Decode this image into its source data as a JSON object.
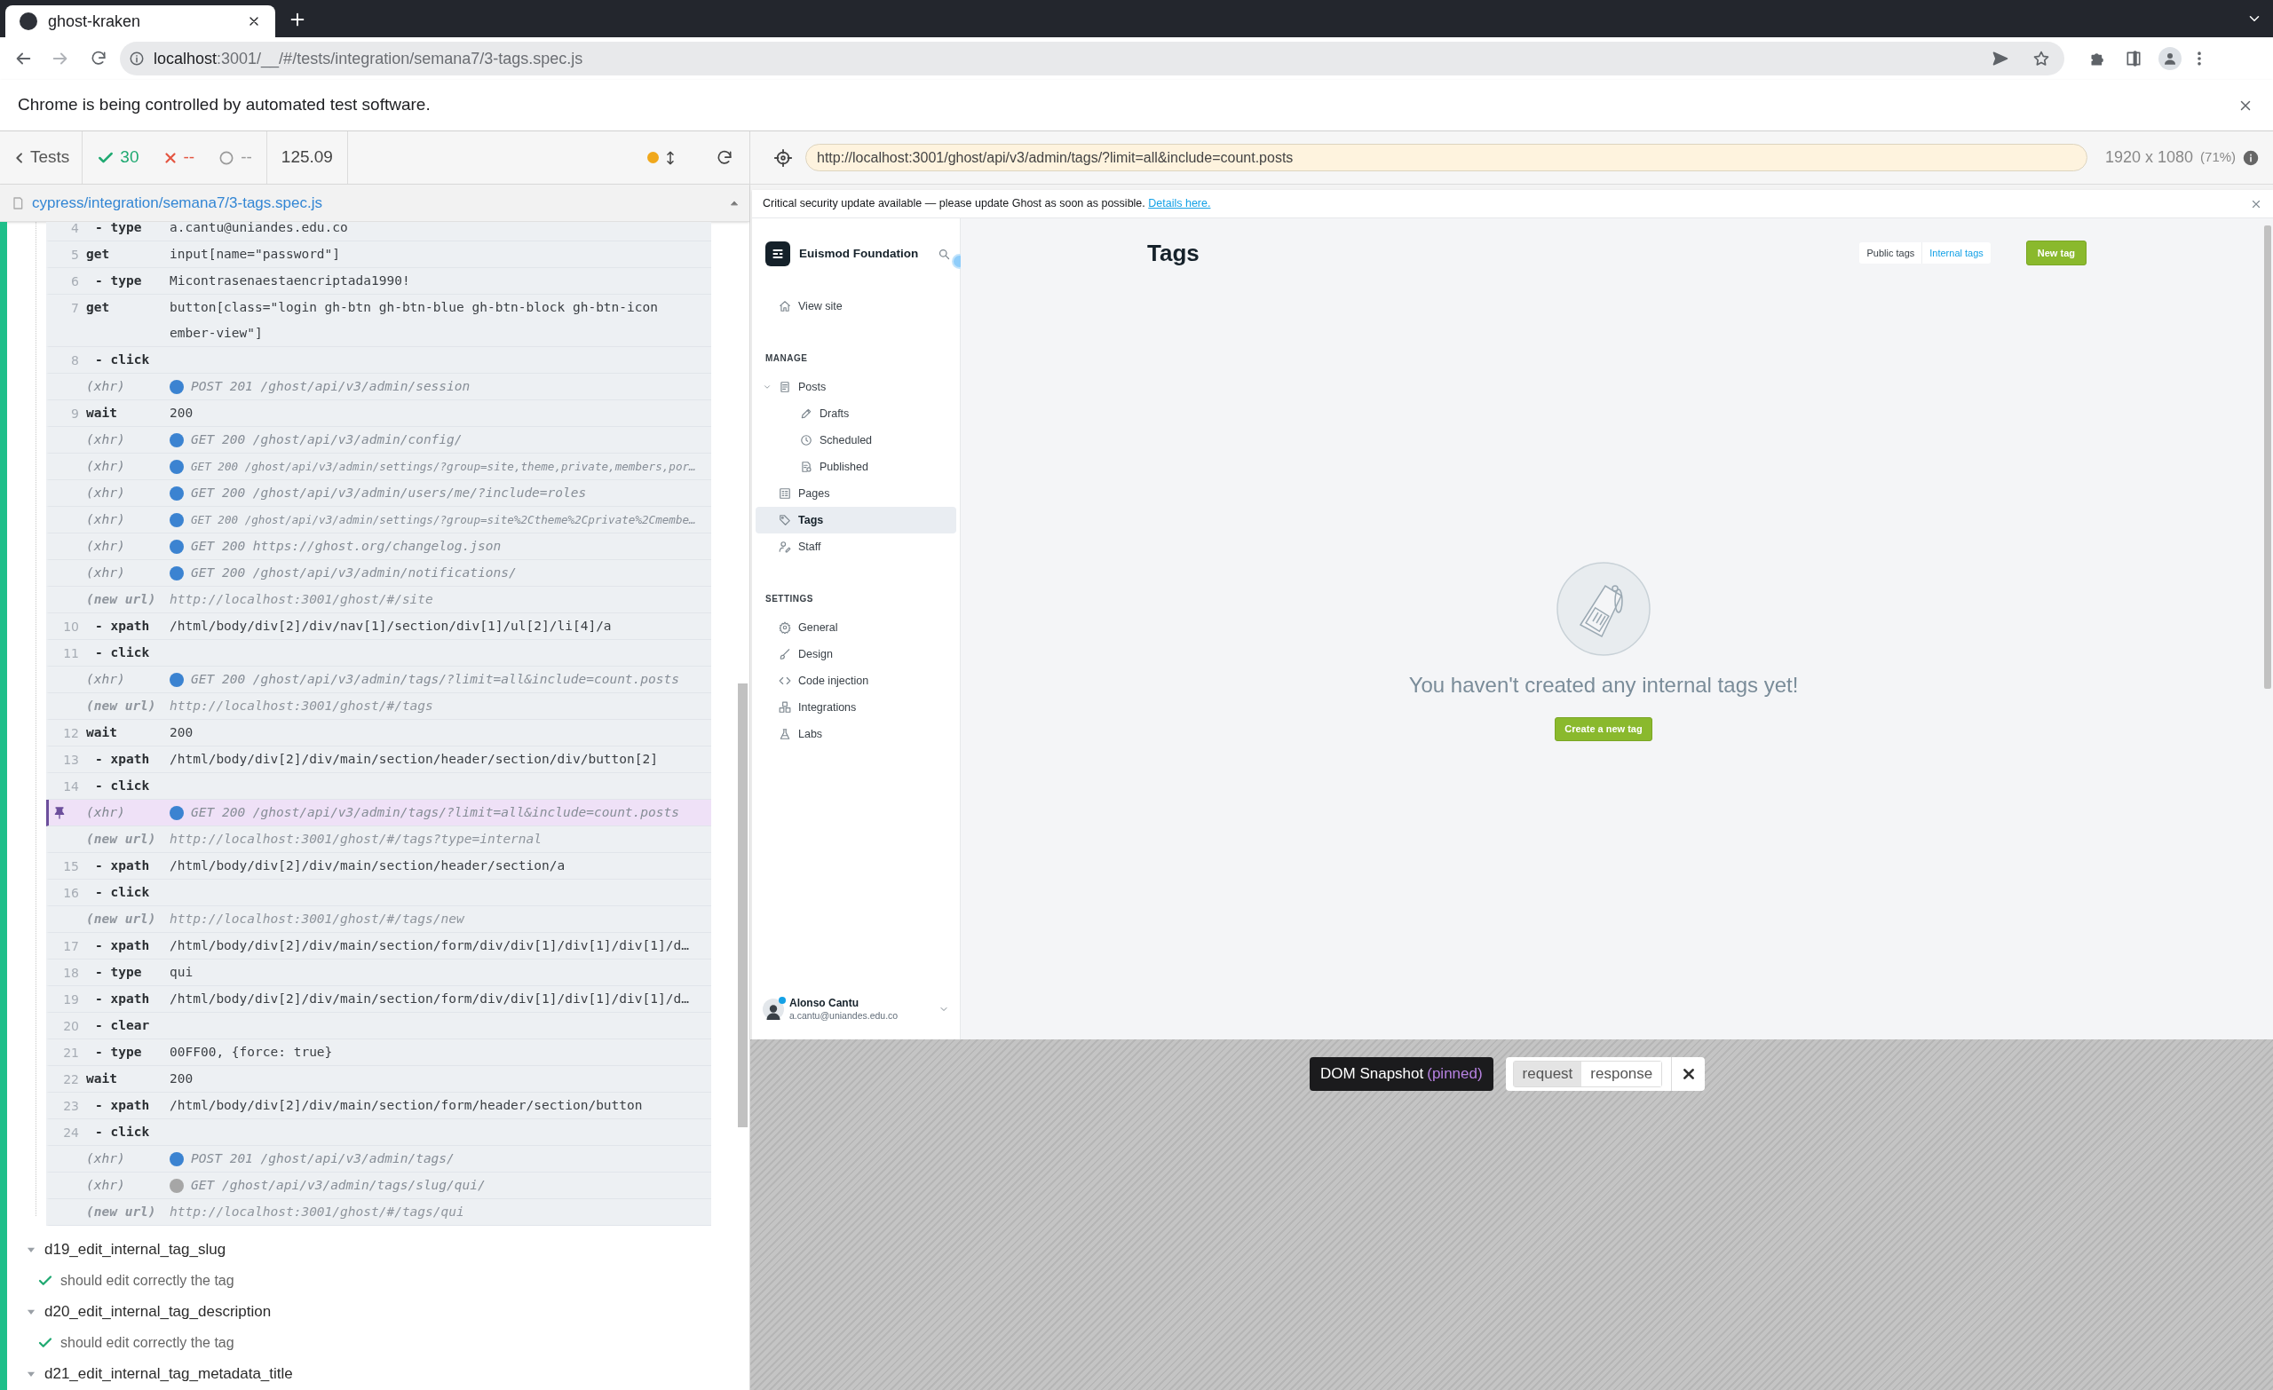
{
  "browser": {
    "tab_title": "ghost-kraken",
    "url_host": "localhost",
    "url_path": ":3001/__/#/tests/integration/semana7/3-tags.spec.js",
    "infobar": "Chrome is being controlled by automated test software."
  },
  "runner": {
    "back_label": "Tests",
    "passed": "30",
    "failed": "--",
    "pending": "--",
    "duration": "125.09",
    "spec_path": "cypress/integration/semana7/3-tags.spec.js",
    "aut_url": "http://localhost:3001/ghost/api/v3/admin/tags/?limit=all&include=count.posts",
    "viewport": "1920 x 1080",
    "scale": "(71%)"
  },
  "command_log": [
    {
      "number": "4",
      "kind": "child",
      "name": "- type",
      "message": "a.cantu@uniandes.edu.co",
      "pinned": false,
      "dense": false
    },
    {
      "number": "5",
      "kind": "command",
      "name": "get",
      "message": "input[name=\"password\"]",
      "pinned": false,
      "dense": false
    },
    {
      "number": "6",
      "kind": "child",
      "name": "- type",
      "message": "Micontrasenaestaencriptada1990!",
      "pinned": false,
      "dense": false
    },
    {
      "number": "7",
      "kind": "command",
      "name": "get",
      "message": "button[class=\"login gh-btn gh-btn-blue gh-btn-block gh-btn-icon ember-view\"]",
      "pinned": false,
      "dense": false
    },
    {
      "number": "8",
      "kind": "child",
      "name": "- click",
      "pinned": false
    },
    {
      "kind": "xhr",
      "name": "(xhr)",
      "message": "POST 201 /ghost/api/v3/admin/session",
      "color": "#3b83d1",
      "pinned": false,
      "dense": false
    },
    {
      "number": "9",
      "kind": "command",
      "name": "wait",
      "message": "200",
      "pinned": false,
      "dense": false
    },
    {
      "kind": "xhr",
      "name": "(xhr)",
      "message": "GET 200 /ghost/api/v3/admin/config/",
      "color": "#3b83d1",
      "pinned": false,
      "dense": false
    },
    {
      "kind": "xhr",
      "name": "(xhr)",
      "message": "GET 200 /ghost/api/v3/admin/settings/?group=site,theme,private,members,por…",
      "color": "#3b83d1",
      "pinned": false,
      "dense": true
    },
    {
      "kind": "xhr",
      "name": "(xhr)",
      "message": "GET 200 /ghost/api/v3/admin/users/me/?include=roles",
      "color": "#3b83d1",
      "pinned": false,
      "dense": false
    },
    {
      "kind": "xhr",
      "name": "(xhr)",
      "message": "GET 200 /ghost/api/v3/admin/settings/?group=site%2Ctheme%2Cprivate%2Cmembe…",
      "color": "#3b83d1",
      "pinned": false,
      "dense": true
    },
    {
      "kind": "xhr",
      "name": "(xhr)",
      "message": "GET 200 https://ghost.org/changelog.json",
      "color": "#3b83d1",
      "pinned": false,
      "dense": false
    },
    {
      "kind": "xhr",
      "name": "(xhr)",
      "message": "GET 200 /ghost/api/v3/admin/notifications/",
      "color": "#3b83d1",
      "pinned": false,
      "dense": false
    },
    {
      "kind": "newurl",
      "name": "(new url)",
      "message": "http://localhost:3001/ghost/#/site",
      "pinned": false,
      "dense": false
    },
    {
      "number": "10",
      "kind": "child",
      "name": "- xpath",
      "message": "/html/body/div[2]/div/nav[1]/section/div[1]/ul[2]/li[4]/a",
      "pinned": false,
      "dense": false
    },
    {
      "number": "11",
      "kind": "child",
      "name": "- click",
      "pinned": false
    },
    {
      "kind": "xhr",
      "name": "(xhr)",
      "message": "GET 200 /ghost/api/v3/admin/tags/?limit=all&include=count.posts",
      "color": "#3b83d1",
      "pinned": false,
      "dense": false
    },
    {
      "kind": "newurl",
      "name": "(new url)",
      "message": "http://localhost:3001/ghost/#/tags",
      "pinned": false,
      "dense": false
    },
    {
      "number": "12",
      "kind": "command",
      "name": "wait",
      "message": "200",
      "pinned": false,
      "dense": false
    },
    {
      "number": "13",
      "kind": "child",
      "name": "- xpath",
      "message": "/html/body/div[2]/div/main/section/header/section/div/button[2]",
      "pinned": false,
      "dense": false
    },
    {
      "number": "14",
      "kind": "child",
      "name": "- click",
      "pinned": false
    },
    {
      "kind": "xhr",
      "name": "(xhr)",
      "message": "GET 200 /ghost/api/v3/admin/tags/?limit=all&include=count.posts",
      "color": "#3b83d1",
      "pinned": true,
      "dense": false
    },
    {
      "kind": "newurl",
      "name": "(new url)",
      "message": "http://localhost:3001/ghost/#/tags?type=internal",
      "pinned": false,
      "dense": false
    },
    {
      "number": "15",
      "kind": "child",
      "name": "- xpath",
      "message": "/html/body/div[2]/div/main/section/header/section/a",
      "pinned": false,
      "dense": false
    },
    {
      "number": "16",
      "kind": "child",
      "name": "- click",
      "pinned": false
    },
    {
      "kind": "newurl",
      "name": "(new url)",
      "message": "http://localhost:3001/ghost/#/tags/new",
      "pinned": false,
      "dense": false
    },
    {
      "number": "17",
      "kind": "child",
      "name": "- xpath",
      "message": "/html/body/div[2]/div/main/section/form/div/div[1]/div[1]/div[1]/d…",
      "pinned": false,
      "dense": false
    },
    {
      "number": "18",
      "kind": "child",
      "name": "- type",
      "message": "qui",
      "pinned": false,
      "dense": false
    },
    {
      "number": "19",
      "kind": "child",
      "name": "- xpath",
      "message": "/html/body/div[2]/div/main/section/form/div/div[1]/div[1]/div[1]/d…",
      "pinned": false,
      "dense": false
    },
    {
      "number": "20",
      "kind": "child",
      "name": "- clear",
      "pinned": false
    },
    {
      "number": "21",
      "kind": "child",
      "name": "- type",
      "message": "00FF00, {force: true}",
      "pinned": false,
      "dense": false
    },
    {
      "number": "22",
      "kind": "command",
      "name": "wait",
      "message": "200",
      "pinned": false,
      "dense": false
    },
    {
      "number": "23",
      "kind": "child",
      "name": "- xpath",
      "message": "/html/body/div[2]/div/main/section/form/header/section/button",
      "pinned": false,
      "dense": false
    },
    {
      "number": "24",
      "kind": "child",
      "name": "- click",
      "pinned": false
    },
    {
      "kind": "xhr",
      "name": "(xhr)",
      "message": "POST 201 /ghost/api/v3/admin/tags/",
      "color": "#3b83d1",
      "pinned": false,
      "dense": false
    },
    {
      "kind": "xhr",
      "name": "(xhr)",
      "message": "GET /ghost/api/v3/admin/tags/slug/qui/",
      "color": "#a6a6a6",
      "pinned": false,
      "dense": false
    },
    {
      "kind": "newurl",
      "name": "(new url)",
      "message": "http://localhost:3001/ghost/#/tags/qui",
      "pinned": false,
      "dense": false
    }
  ],
  "suites": [
    {
      "title": "d19_edit_internal_tag_slug",
      "expanded": true,
      "tests": [
        {
          "title": "should edit correctly the tag",
          "passed": true
        }
      ]
    },
    {
      "title": "d20_edit_internal_tag_description",
      "expanded": true,
      "tests": [
        {
          "title": "should edit correctly the tag",
          "passed": true
        }
      ]
    },
    {
      "title": "d21_edit_internal_tag_metadata_title",
      "expanded": true
    }
  ],
  "ghost": {
    "alert": "Critical security update available — please update Ghost as soon as possible.",
    "alert_link": "Details here.",
    "site_title": "Euismod Foundation",
    "view_site": "View site",
    "sections": [
      {
        "heading": "MANAGE",
        "items": [
          {
            "label": "Posts",
            "selected": false,
            "expanded": true,
            "children": [
              {
                "label": "Drafts",
                "selected": false
              },
              {
                "label": "Scheduled",
                "selected": false
              },
              {
                "label": "Published",
                "selected": false
              }
            ]
          },
          {
            "label": "Pages",
            "selected": false
          },
          {
            "label": "Tags",
            "selected": true
          },
          {
            "label": "Staff",
            "selected": false
          }
        ]
      },
      {
        "heading": "SETTINGS",
        "items": [
          {
            "label": "General",
            "selected": false
          },
          {
            "label": "Design",
            "selected": false
          },
          {
            "label": "Code injection",
            "selected": false
          },
          {
            "label": "Integrations",
            "selected": false
          },
          {
            "label": "Labs",
            "selected": false
          }
        ]
      }
    ],
    "user": {
      "name": "Alonso Cantu",
      "email": "a.cantu@uniandes.edu.co"
    },
    "page_title": "Tags",
    "tabs": [
      {
        "label": "Public tags",
        "selected": false
      },
      {
        "label": "Internal tags",
        "selected": true
      }
    ],
    "new_button": "New tag",
    "empty_message": "You haven't created any internal tags yet!",
    "create_button": "Create a new tag"
  },
  "snapshot": {
    "label": "DOM Snapshot",
    "state": "(pinned)",
    "toggles": [
      {
        "label": "request",
        "selected": true
      },
      {
        "label": "response",
        "selected": false
      }
    ]
  }
}
